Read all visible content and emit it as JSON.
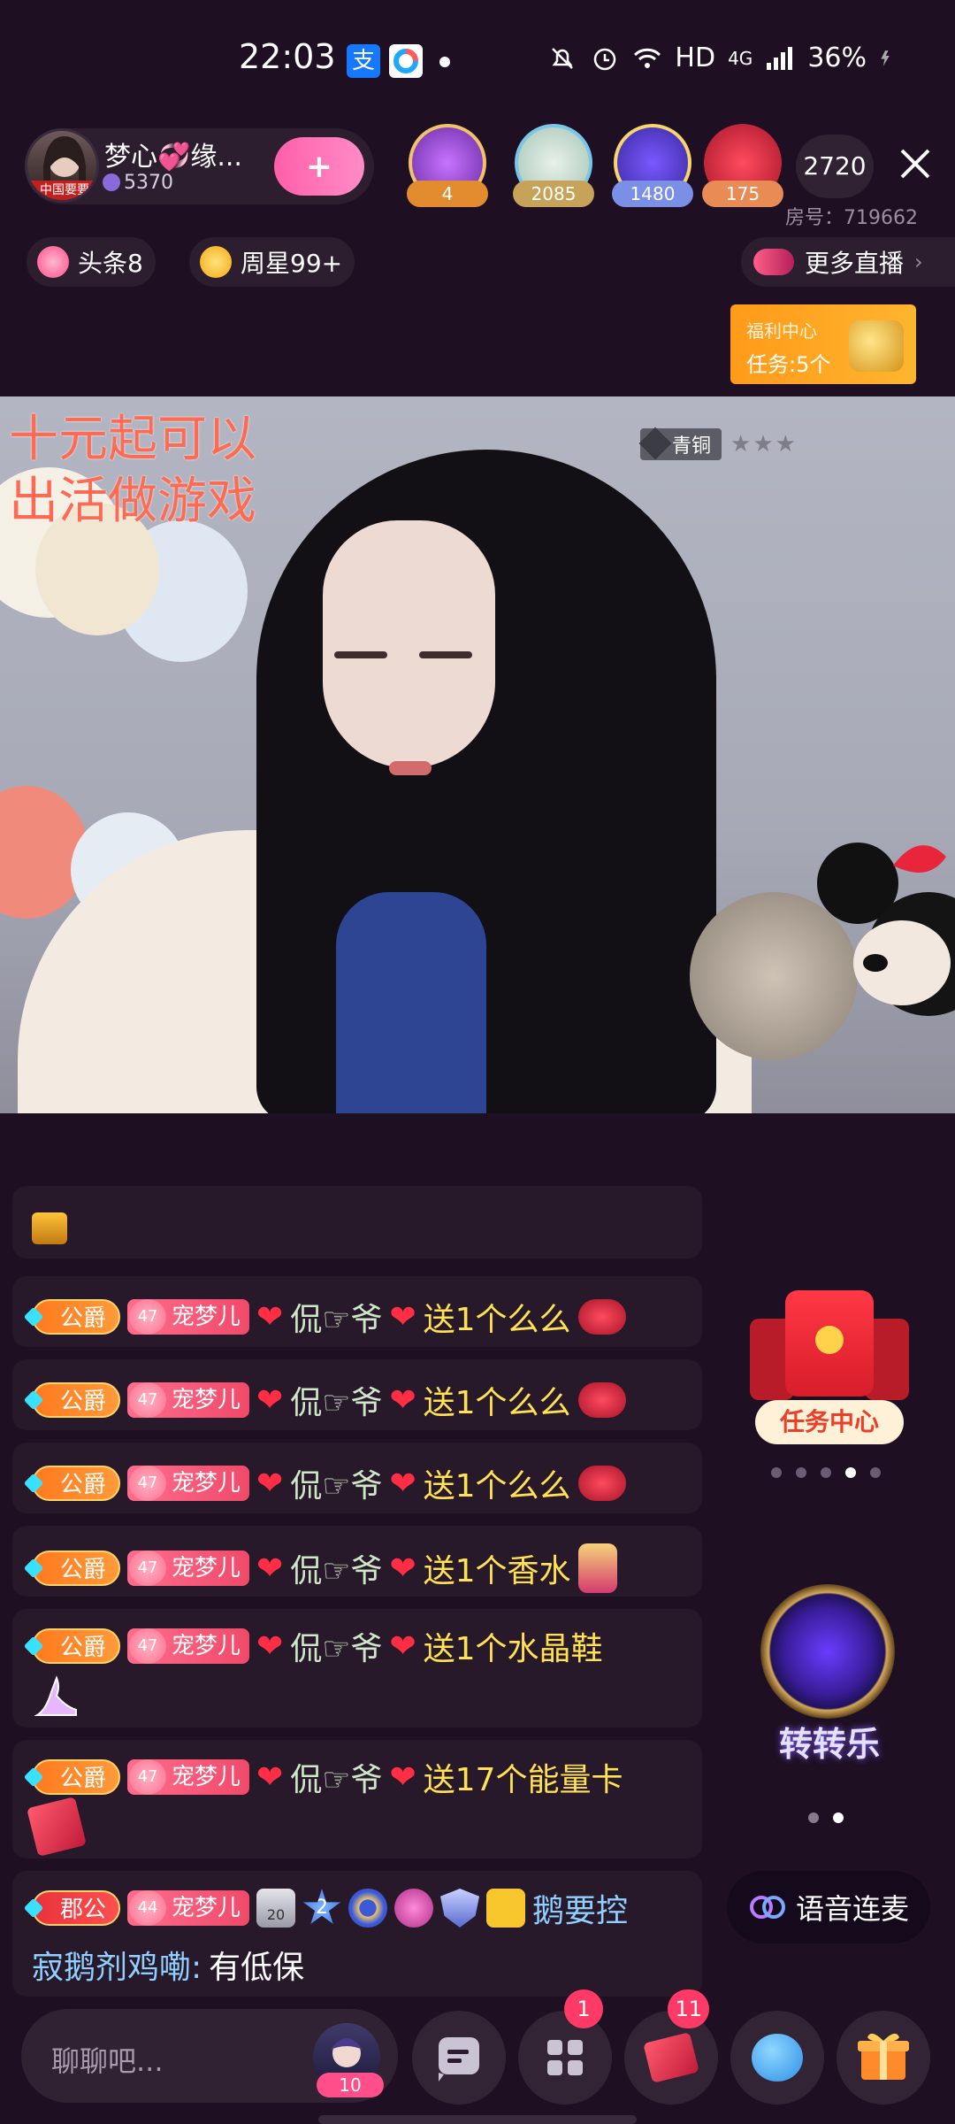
{
  "status_bar": {
    "time": "22:03",
    "network": "HD",
    "signal": "4G",
    "battery": "36%"
  },
  "host": {
    "name": "梦心💞缘...",
    "count": "5370",
    "avatar_tag": "中国要要",
    "follow_label": "+"
  },
  "fan_badges": [
    {
      "value": "4",
      "color": "#e28b2f"
    },
    {
      "value": "2085",
      "color": "#c7a35a"
    },
    {
      "value": "1480",
      "color": "#7b8fe6"
    },
    {
      "value": "175",
      "color": "#e88b54"
    }
  ],
  "viewer_count": "2720",
  "room_id": "房号：719662",
  "chips": {
    "headline": "头条8",
    "weekly_star": "周星99+",
    "more_live": "更多直播"
  },
  "welfare": {
    "title": "福利中心",
    "task": "任务:5个"
  },
  "video": {
    "overlay_text_1": "十元起可以",
    "overlay_text_2": "出活做游戏",
    "rank": "青铜",
    "stars": "★★★"
  },
  "chat": [
    {
      "noble": "公爵",
      "fan_level": "47",
      "fan_name": "宠梦儿",
      "user": "侃☞爷",
      "gift": "送1个么么",
      "gift_icon": "lips-icon"
    },
    {
      "noble": "公爵",
      "fan_level": "47",
      "fan_name": "宠梦儿",
      "user": "侃☞爷",
      "gift": "送1个么么",
      "gift_icon": "lips-icon"
    },
    {
      "noble": "公爵",
      "fan_level": "47",
      "fan_name": "宠梦儿",
      "user": "侃☞爷",
      "gift": "送1个么么",
      "gift_icon": "lips-icon"
    },
    {
      "noble": "公爵",
      "fan_level": "47",
      "fan_name": "宠梦儿",
      "user": "侃☞爷",
      "gift": "送1个香水",
      "gift_icon": "perfume-icon"
    },
    {
      "noble": "公爵",
      "fan_level": "47",
      "fan_name": "宠梦儿",
      "user": "侃☞爷",
      "gift": "送1个水晶鞋",
      "gift_icon": "crystal-shoe-icon"
    },
    {
      "noble": "公爵",
      "fan_level": "47",
      "fan_name": "宠梦儿",
      "user": "侃☞爷",
      "gift": "送17个能量卡",
      "gift_icon": "energy-card-icon"
    }
  ],
  "last_message": {
    "noble": "郡公",
    "fan_level": "44",
    "fan_name": "宠梦儿",
    "badge_level": "20",
    "badge_num": "2",
    "user_name_1": "鹅要控",
    "user_name_2": "寂鹅剂鸡嘞:",
    "text": "有低保"
  },
  "right_widgets": {
    "task_center": "任务中心",
    "spin_game": "转转乐",
    "voice_link": "语音连麦"
  },
  "bottom_bar": {
    "input_placeholder": "聊聊吧...",
    "my_level": "10",
    "apps_badge": "1",
    "gift_card_badge": "11"
  },
  "colors": {
    "background": "#1f0f22",
    "gift_text": "#ffe252",
    "user_name": "#cfe7c9",
    "accent_pink": "#ff5fa8"
  }
}
